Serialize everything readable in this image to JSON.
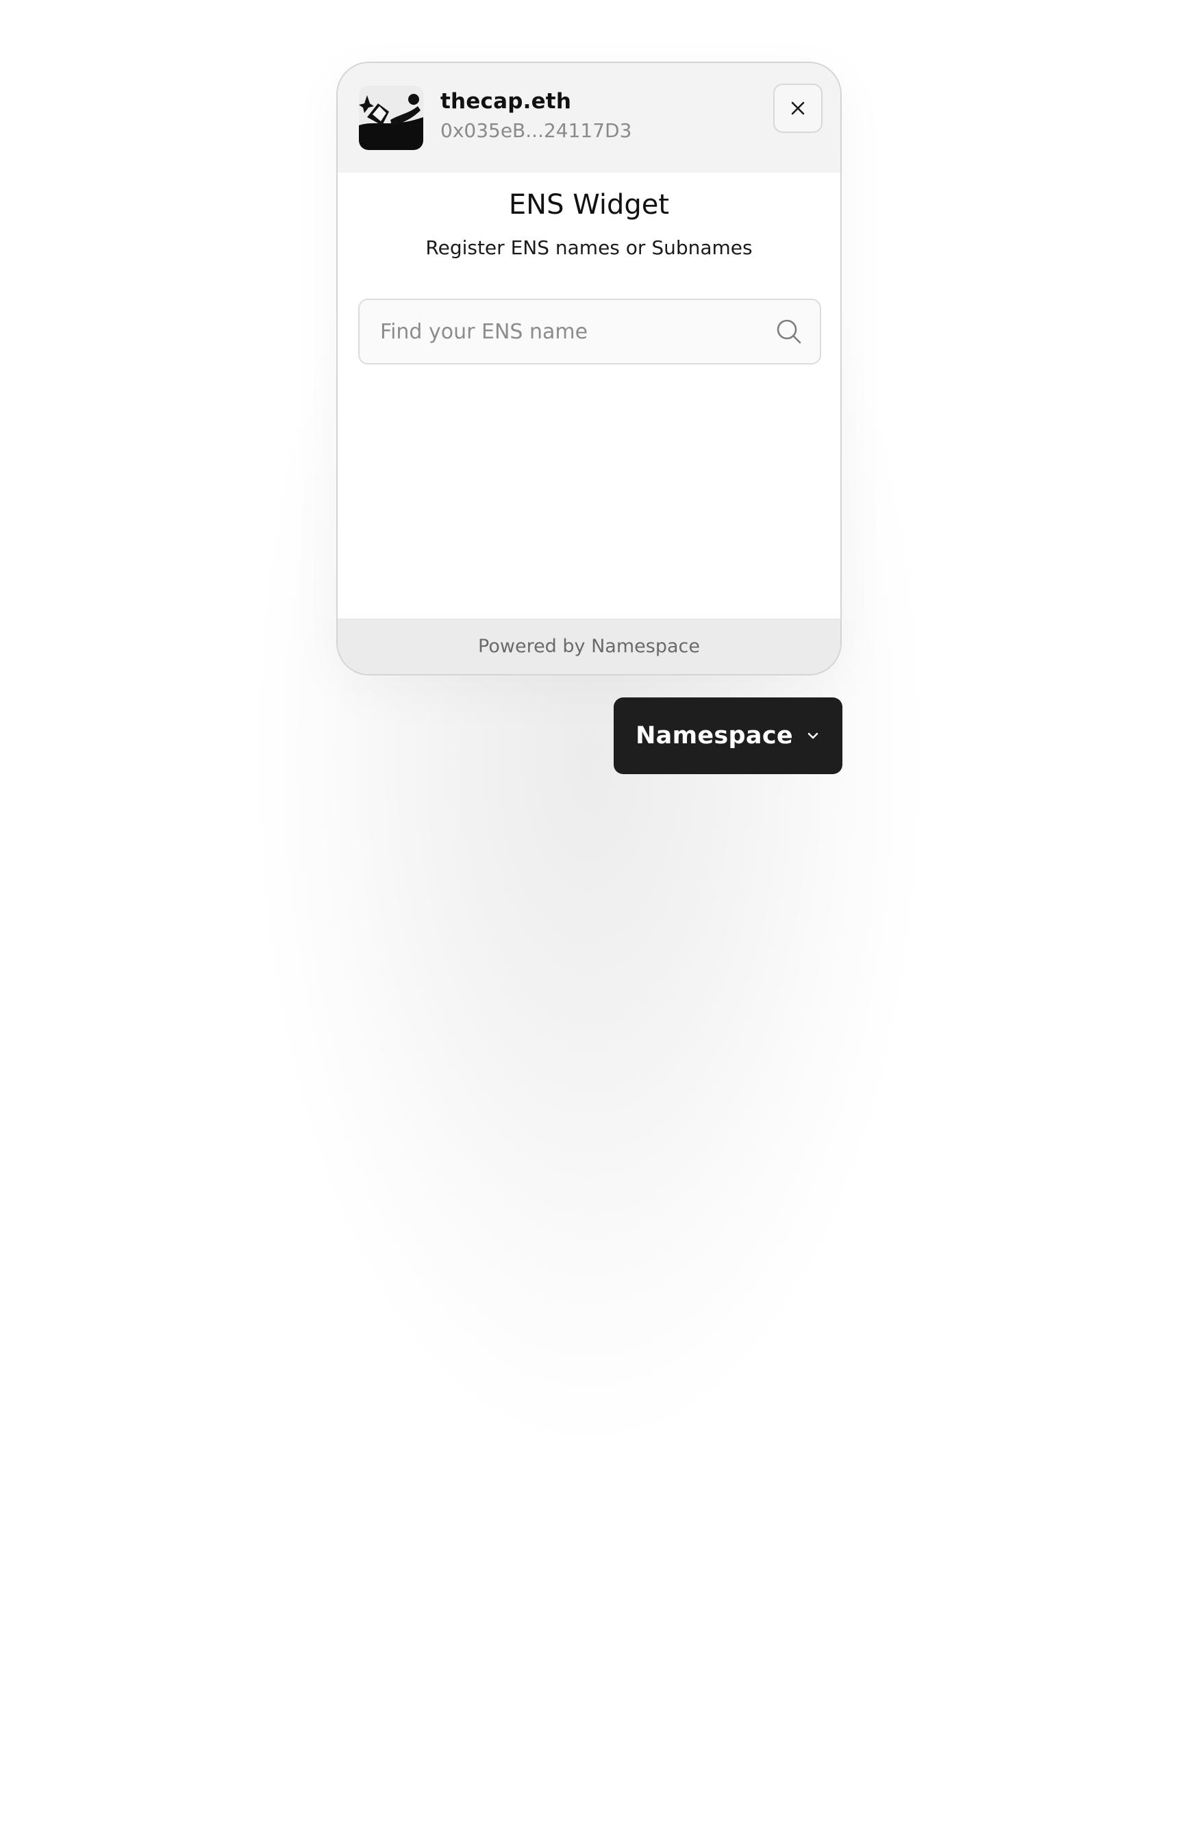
{
  "account": {
    "name": "thecap.eth",
    "address": "0x035eB...24117D3",
    "avatar_icon": "avatar-image"
  },
  "header": {
    "close_icon": "close-icon"
  },
  "widget": {
    "title": "ENS Widget",
    "subtitle": "Register ENS names or Subnames"
  },
  "search": {
    "placeholder": "Find your ENS name",
    "value": "",
    "icon": "search-icon"
  },
  "footer": {
    "text": "Powered by Namespace"
  },
  "launcher": {
    "label": "Namespace",
    "icon": "chevron-down-icon"
  },
  "colors": {
    "header_bg": "#f3f3f3",
    "footer_bg": "#ebebeb",
    "button_bg": "#1e1e1e",
    "button_text": "#ffffff",
    "muted_text": "#8a8a8a"
  }
}
